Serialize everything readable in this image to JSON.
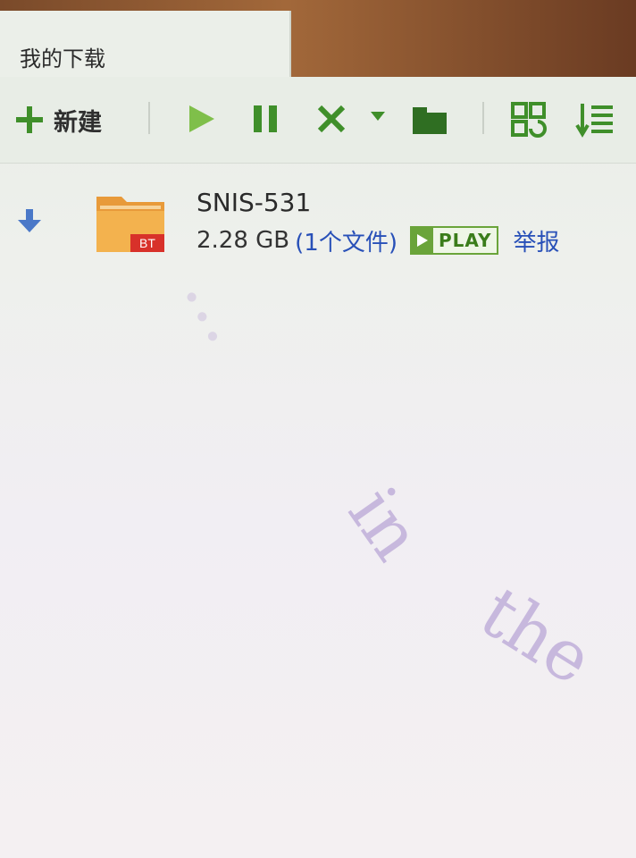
{
  "window": {
    "tab_title": "我的下载"
  },
  "toolbar": {
    "new_label": "新建",
    "buttons": [
      {
        "icon": "plus-icon"
      },
      {
        "icon": "play-icon"
      },
      {
        "icon": "pause-icon"
      },
      {
        "icon": "delete-icon"
      },
      {
        "icon": "dropdown-icon"
      },
      {
        "icon": "folder-icon"
      },
      {
        "icon": "grid-view-icon"
      },
      {
        "icon": "sort-list-icon"
      }
    ],
    "colors": {
      "accent": "#3f8f2a"
    }
  },
  "downloads": [
    {
      "name": "SNIS-531",
      "size": "2.28 GB",
      "file_count": "(1个文件)",
      "badge": "BT",
      "play_label": "PLAY",
      "report_label": "举报",
      "status_icon": "download-arrow-icon"
    }
  ],
  "watermark": {
    "segment1": "...",
    "segment2": "in",
    "segment3": "the"
  }
}
